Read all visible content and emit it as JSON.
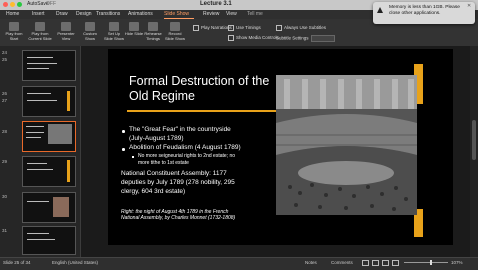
{
  "window": {
    "title": "Lecture 3.1",
    "autosave": "AutoSave",
    "autosave_state": "OFF"
  },
  "tabs": [
    "Home",
    "Insert",
    "Draw",
    "Design",
    "Transitions",
    "Animations",
    "Slide Show",
    "Review",
    "View",
    "Tell me"
  ],
  "ribbon": {
    "buttons": [
      "Play from Start",
      "Play from Current Slide",
      "Presenter View",
      "Custom Show",
      "Set Up Slide Show",
      "Hide Slide",
      "Rehearse Timings",
      "Record Slide Show"
    ],
    "options": {
      "narrations": "Play Narrations",
      "timings": "Use Timings",
      "media_controls": "Show Media Controls",
      "subtitles": "Always Use Subtitles",
      "subtitle_settings": "Subtitle Settings"
    }
  },
  "slide_numbers": [
    "24",
    "25",
    "26",
    "27",
    "28",
    "29",
    "30",
    "31"
  ],
  "slide": {
    "title": "Formal Destruction of the Old Regime",
    "bullet1": "The \"Great Fear\" in the countryside",
    "bullet1_date": "(July-August 1789)",
    "bullet2": "Abolition of Feudalism (4 August 1789)",
    "sub1": "No more seigneurial rights to 2nd estate; no",
    "sub1b": "more tithe to 1st estate",
    "para_lines": [
      "National Constituent Assembly: 1177",
      "deputies by July 1789 (278 nobility, 295",
      "clergy, 604 3rd estate)"
    ],
    "caption_lines": [
      "Right: the night of August 4th 1789 in the French",
      "National Assembly, by Charles Monnet (1732-1808)"
    ]
  },
  "status": {
    "slide_info": "Slide 25 of 34",
    "language": "English (United States)",
    "notes": "Notes",
    "comments": "Comments",
    "zoom": "107%"
  },
  "notification": {
    "message": "Memory is less than 1GB. Please close other applications."
  },
  "colors": {
    "accent": "#e8a21a",
    "slide_bg": "#000000",
    "active_tab": "#ff9d63"
  }
}
